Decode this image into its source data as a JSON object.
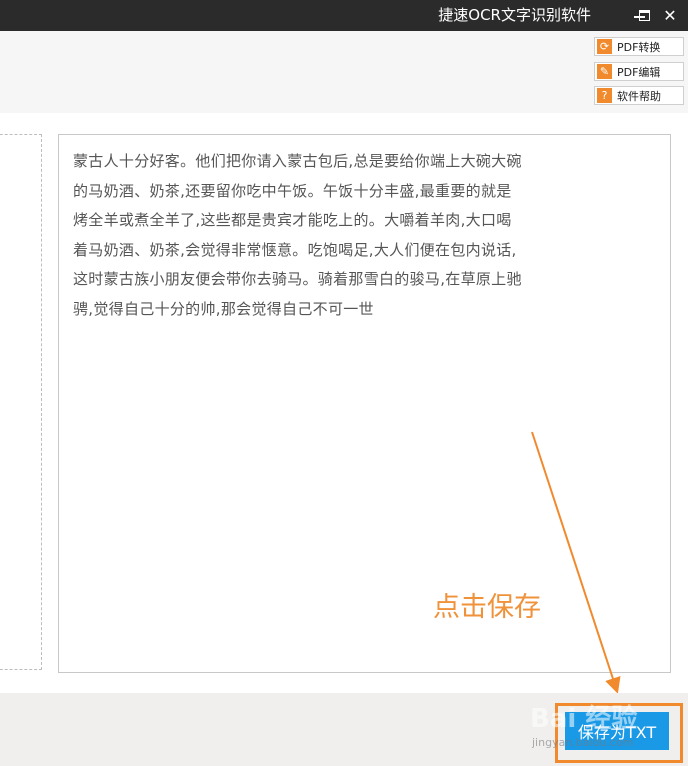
{
  "window": {
    "title": "捷速OCR文字识别软件",
    "controls": {
      "minimize": "minimize",
      "maximize": "maximize",
      "close": "✕"
    }
  },
  "toolbar": {
    "buttons": [
      {
        "label": "PDF转换",
        "icon": "convert-icon",
        "icon_glyph": "⟳"
      },
      {
        "label": "PDF编辑",
        "icon": "edit-icon",
        "icon_glyph": "✎"
      },
      {
        "label": "软件帮助",
        "icon": "help-icon",
        "icon_glyph": "?"
      }
    ]
  },
  "result": {
    "lines": [
      "蒙古人十分好客。他们把你请入蒙古包后,总是要给你端上大碗大碗",
      "的马奶酒、奶茶,还要留你吃中午饭。午饭十分丰盛,最重要的就是",
      "烤全羊或煮全羊了,这些都是贵宾才能吃上的。大嚼着羊肉,大口喝",
      "着马奶酒、奶茶,会觉得非常惬意。吃饱喝足,大人们便在包内说话,",
      "这时蒙古族小朋友便会带你去骑马。骑着那雪白的骏马,在草原上驰",
      "骋,觉得自己十分的帅,那会觉得自己不可一世"
    ]
  },
  "annotation": {
    "label": "点击保存",
    "color": "#f0923a"
  },
  "save": {
    "label": "保存为TXT"
  },
  "watermark": {
    "text": "Bai 经验",
    "sub": "jingyan.baidu.com"
  },
  "colors": {
    "titlebar": "#2b2b2b",
    "accent_orange": "#f08a2c",
    "save_button": "#1a99e6"
  }
}
